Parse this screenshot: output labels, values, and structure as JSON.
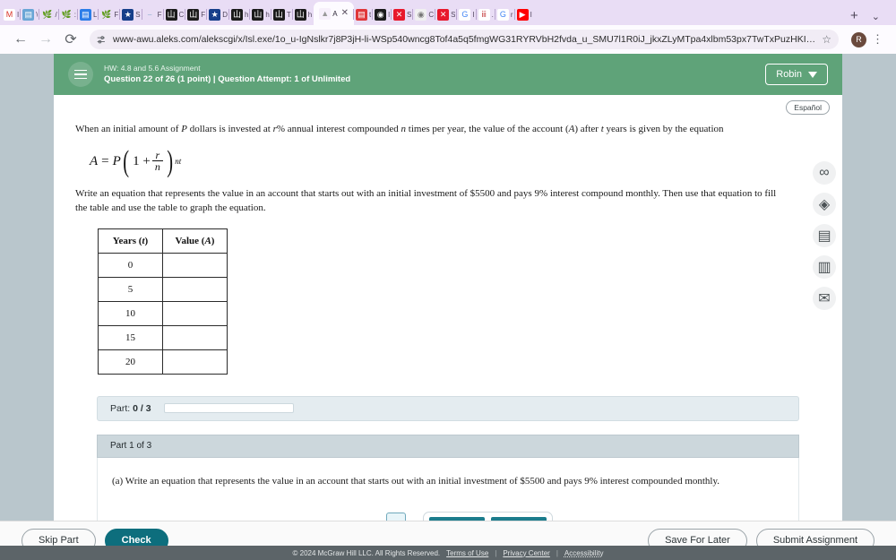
{
  "browser": {
    "tabs": [
      {
        "label": "I",
        "icon": "gmail-icon",
        "color": "#ffffff",
        "glyph": "M",
        "fg": "#d93025",
        "active": false
      },
      {
        "label": "\\",
        "icon": "photo-icon",
        "color": "#6aa6d6",
        "glyph": "▤",
        "fg": "#ffffff",
        "active": false
      },
      {
        "label": "/",
        "icon": "plant-icon",
        "color": "#e9ddf5",
        "glyph": "🌿",
        "fg": "#4d9e6a",
        "active": false
      },
      {
        "label": ":",
        "icon": "plant-icon",
        "color": "#e9ddf5",
        "glyph": "🌿",
        "fg": "#4d9e6a",
        "active": false
      },
      {
        "label": "L",
        "icon": "docs-icon",
        "color": "#2b7de9",
        "glyph": "▤",
        "fg": "#ffffff",
        "active": false
      },
      {
        "label": "F",
        "icon": "plant-icon",
        "color": "#e9ddf5",
        "glyph": "🌿",
        "fg": "#4d9e6a",
        "active": false
      },
      {
        "label": "S",
        "icon": "shield-star-icon",
        "color": "#173f8a",
        "glyph": "★",
        "fg": "#ffffff",
        "active": false
      },
      {
        "label": "F",
        "icon": "link-icon",
        "color": "#e9ddf5",
        "glyph": "⎯",
        "fg": "#7fa8c9",
        "active": false
      },
      {
        "label": "C",
        "icon": "aleks-icon",
        "color": "#1b1b1b",
        "glyph": "山",
        "fg": "#ffffff",
        "active": false
      },
      {
        "label": "F",
        "icon": "aleks-icon",
        "color": "#1b1b1b",
        "glyph": "山",
        "fg": "#ffffff",
        "active": false
      },
      {
        "label": "D",
        "icon": "shield-star-icon",
        "color": "#173f8a",
        "glyph": "★",
        "fg": "#ffffff",
        "active": false
      },
      {
        "label": "h",
        "icon": "aleks-icon",
        "color": "#1b1b1b",
        "glyph": "山",
        "fg": "#ffffff",
        "active": false
      },
      {
        "label": "h",
        "icon": "aleks-icon",
        "color": "#1b1b1b",
        "glyph": "山",
        "fg": "#ffffff",
        "active": false
      },
      {
        "label": "T",
        "icon": "aleks-icon",
        "color": "#1b1b1b",
        "glyph": "山",
        "fg": "#ffffff",
        "active": false
      },
      {
        "label": "h",
        "icon": "aleks-icon",
        "color": "#1b1b1b",
        "glyph": "山",
        "fg": "#ffffff",
        "active": false
      },
      {
        "label": "A",
        "icon": "aleks-icon",
        "color": "#f7f0fb",
        "glyph": "▲",
        "fg": "#999999",
        "active": true
      },
      {
        "label": "t",
        "icon": "calendar-icon",
        "color": "#e0373a",
        "glyph": "▤",
        "fg": "#ffffff",
        "active": false
      },
      {
        "label": "l",
        "icon": "fingerprint-icon",
        "color": "#1b1b1b",
        "glyph": "◉",
        "fg": "#ffffff",
        "active": false
      },
      {
        "label": "S",
        "icon": "x-red-icon",
        "color": "#e8192c",
        "glyph": "✕",
        "fg": "#ffffff",
        "active": false
      },
      {
        "label": "C",
        "icon": "fingerprint-icon",
        "color": "#f0f0f0",
        "glyph": "◉",
        "fg": "#777777",
        "active": false
      },
      {
        "label": "S",
        "icon": "x-red-icon",
        "color": "#e8192c",
        "glyph": "✕",
        "fg": "#ffffff",
        "active": false
      },
      {
        "label": "I",
        "icon": "google-icon",
        "color": "#ffffff",
        "glyph": "G",
        "fg": "#4285f4",
        "active": false
      },
      {
        "label": ".",
        "icon": "bars-icon",
        "color": "#ffffff",
        "glyph": "ⅲ",
        "fg": "#c84a4a",
        "active": false
      },
      {
        "label": "r",
        "icon": "google-icon",
        "color": "#ffffff",
        "glyph": "G",
        "fg": "#4285f4",
        "active": false
      },
      {
        "label": "I",
        "icon": "youtube-icon",
        "color": "#ff0000",
        "glyph": "▶",
        "fg": "#ffffff",
        "active": false
      }
    ],
    "new_tab_label": "+",
    "tab_list_chevron": "⌄",
    "back_label": "←",
    "forward_label": "→",
    "reload_label": "⟳",
    "url": "www-awu.aleks.com/alekscgi/x/Isl.exe/1o_u-IgNslkr7j8P3jH-li-WSp540wncg8Tof4a5q5fmgWG31RYRVbH2fvda_u_SMU7l1R0iJ_jkxZLyMTpa4xlbm53px7TwTxPuzHKIjbHdcA...",
    "site_info_icon": "tune-icon",
    "bookmark_star": "☆",
    "profile_initial": "R",
    "menu_glyph": "⋮"
  },
  "aleks": {
    "menu_icon": "hamburger-icon",
    "hw_title": "HW: 4.8 and 5.6 Assignment",
    "question_line": "Question 22 of 26 (1 point)  |  Question Attempt: 1 of Unlimited",
    "user_name": "Robin",
    "language_button": "Español"
  },
  "question": {
    "intro_part1": "When an initial amount of ",
    "var_P": "P",
    "intro_part2": " dollars is invested at ",
    "var_r": "r",
    "intro_part3": "% annual interest compounded ",
    "var_n": "n",
    "intro_part4": " times per year, the value of the account (",
    "var_A": "A",
    "intro_part5": ") after ",
    "var_t": "t",
    "intro_part6": " years is given by the equation",
    "formula": {
      "lhs_A": "A",
      "equals": "=",
      "P": "P",
      "one_plus": "1 +",
      "numerator": "r",
      "denominator": "n",
      "exponent": "nt"
    },
    "instruction": "Write an equation that represents the value in an account that starts out with an initial investment of $5500 and pays 9% interest compound monthly. Then use that equation to fill the table and use the table to graph the equation.",
    "table": {
      "headers": [
        "Years (t)",
        "Value (A)"
      ],
      "rows": [
        {
          "years": "0",
          "value": ""
        },
        {
          "years": "5",
          "value": ""
        },
        {
          "years": "10",
          "value": ""
        },
        {
          "years": "15",
          "value": ""
        },
        {
          "years": "20",
          "value": ""
        }
      ]
    }
  },
  "progress": {
    "part_label": "Part:",
    "part_count": "0 / 3",
    "percent": 0
  },
  "part": {
    "heading": "Part 1 of 3",
    "prompt": "(a) Write an equation that represents the value in an account that starts out with an initial investment of $5500 and pays 9% interest compounded monthly."
  },
  "rail_icons": [
    {
      "name": "glasses-icon",
      "glyph": "∞"
    },
    {
      "name": "diamond-arrow-icon",
      "glyph": "◈"
    },
    {
      "name": "notes-icon",
      "glyph": "▤"
    },
    {
      "name": "calculator-icon",
      "glyph": "▥"
    },
    {
      "name": "mail-icon",
      "glyph": "✉"
    }
  ],
  "actions": {
    "skip_part": "Skip Part",
    "check": "Check",
    "save_for_later": "Save For Later",
    "submit_assignment": "Submit Assignment"
  },
  "footer": {
    "copyright": "© 2024 McGraw Hill LLC. All Rights Reserved.",
    "terms": "Terms of Use",
    "privacy": "Privacy Center",
    "accessibility": "Accessibility",
    "separator": "|"
  },
  "colors": {
    "aleks_green": "#5fa379",
    "primary_teal": "#0d6e7d",
    "page_backdrop": "#b9c6cc",
    "browser_purple": "#e9ddf5"
  }
}
